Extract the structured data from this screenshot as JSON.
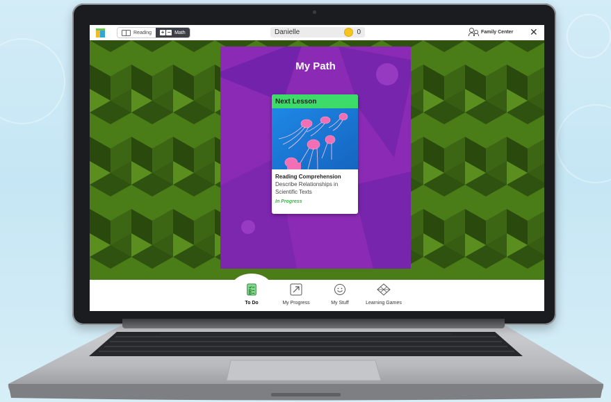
{
  "topbar": {
    "subjects": [
      {
        "label": "Reading",
        "active": false
      },
      {
        "label": "Math",
        "active": true
      }
    ],
    "student_name": "Danielle",
    "coin_count": "0",
    "family_center_label": "Family Center",
    "close_glyph": "✕"
  },
  "panel": {
    "title": "My Path",
    "card": {
      "header": "Next Lesson",
      "category": "Reading Comprehension",
      "description": "Describe Relationships in Scientific Texts",
      "status": "In Progress",
      "image_icon": "jellyfish-illustration"
    }
  },
  "bottom_nav": {
    "items": [
      {
        "label": "To Do",
        "icon": "checklist-icon",
        "active": true
      },
      {
        "label": "My Progress",
        "icon": "progress-icon",
        "active": false
      },
      {
        "label": "My Stuff",
        "icon": "smiley-icon",
        "active": false
      },
      {
        "label": "Learning Games",
        "icon": "games-icon",
        "active": false
      }
    ]
  },
  "colors": {
    "panel_purple": "#8b2bb5",
    "card_header_green": "#3ddc6a",
    "background_green": "#3f6b12",
    "status_green": "#3cb54a",
    "active_subject": "#3c3f45"
  }
}
